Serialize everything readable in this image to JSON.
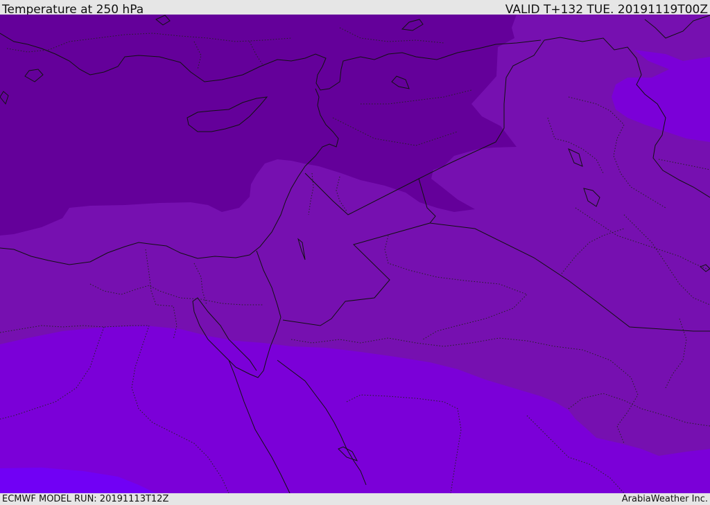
{
  "header": {
    "title": "Temperature at 250 hPa",
    "valid": "VALID T+132 TUE. 20191119T00Z"
  },
  "footer": {
    "model_run": "ECMWF MODEL RUN: 20191113T12Z",
    "credit": "ArabiaWeather Inc."
  },
  "colors": {
    "band_coldest": "#64009a",
    "band_cold": "#7610b0",
    "band_mid": "#7b00d8",
    "band_warm": "#7100f5",
    "borders": "#111111",
    "chrome": "#e6e6e6"
  }
}
